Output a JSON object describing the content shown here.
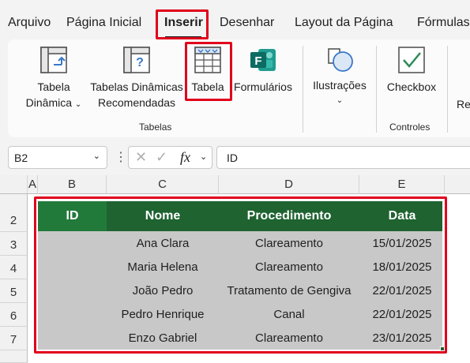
{
  "menu": {
    "tabs": [
      "Arquivo",
      "Página Inicial",
      "Inserir",
      "Desenhar",
      "Layout da Página",
      "Fórmulas"
    ],
    "active": "Inserir"
  },
  "ribbon": {
    "tabela_dinamica": {
      "line1": "Tabela",
      "line2": "Dinâmica"
    },
    "tabelas_recomendadas": {
      "line1": "Tabelas Dinâmicas",
      "line2": "Recomendadas"
    },
    "tabela": "Tabela",
    "formularios": "Formulários",
    "group_tabelas": "Tabelas",
    "ilustracoes": "Ilustrações",
    "checkbox": "Checkbox",
    "group_controles": "Controles",
    "cut_label": "Re"
  },
  "formula_bar": {
    "name_box": "B2",
    "fx_label": "fx",
    "content": "ID"
  },
  "grid": {
    "columns": [
      "A",
      "B",
      "C",
      "D",
      "E"
    ],
    "rows": [
      "2",
      "3",
      "4",
      "5",
      "6",
      "7"
    ]
  },
  "table": {
    "headers": [
      "ID",
      "Nome",
      "Procedimento",
      "Data"
    ],
    "rows": [
      {
        "id": "",
        "nome": "Ana Clara",
        "procedimento": "Clareamento",
        "data": "15/01/2025"
      },
      {
        "id": "",
        "nome": "Maria Helena",
        "procedimento": "Clareamento",
        "data": "18/01/2025"
      },
      {
        "id": "",
        "nome": "João Pedro",
        "procedimento": "Tratamento de Gengiva",
        "data": "22/01/2025"
      },
      {
        "id": "",
        "nome": "Pedro Henrique",
        "procedimento": "Canal",
        "data": "22/01/2025"
      },
      {
        "id": "",
        "nome": "Enzo Gabriel",
        "procedimento": "Clareamento",
        "data": "23/01/2025"
      }
    ]
  },
  "colors": {
    "header_green": "#1e6330",
    "highlight_red": "#e0001b",
    "body_gray": "#c8c8c8"
  }
}
